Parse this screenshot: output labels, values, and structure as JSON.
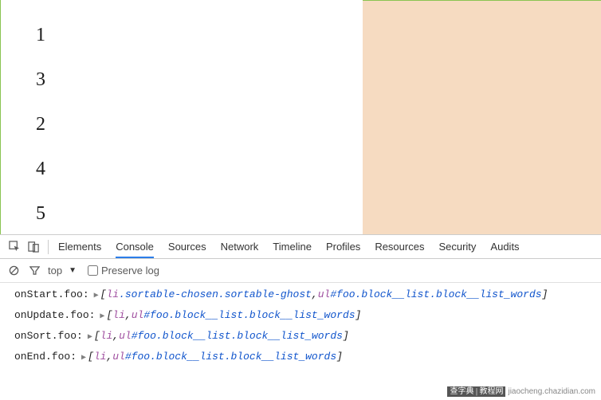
{
  "list": [
    "1",
    "3",
    "2",
    "4",
    "5"
  ],
  "devtools": {
    "tabs": [
      "Elements",
      "Console",
      "Sources",
      "Network",
      "Timeline",
      "Profiles",
      "Resources",
      "Security",
      "Audits"
    ],
    "active_tab": "Console",
    "context": "top",
    "preserve_label": "Preserve log",
    "preserve_checked": false
  },
  "logs": [
    {
      "label": "onStart.foo:",
      "parts": [
        {
          "t": "br",
          "v": "["
        },
        {
          "t": "el",
          "v": "li"
        },
        {
          "t": "sel",
          "v": ".sortable-chosen.sortable-ghost"
        },
        {
          "t": "c",
          "v": ", "
        },
        {
          "t": "el",
          "v": "ul"
        },
        {
          "t": "sel",
          "v": "#foo.block__list.block__list_words"
        },
        {
          "t": "br",
          "v": "]"
        }
      ]
    },
    {
      "label": "onUpdate.foo:",
      "parts": [
        {
          "t": "br",
          "v": "["
        },
        {
          "t": "el",
          "v": "li"
        },
        {
          "t": "c",
          "v": ", "
        },
        {
          "t": "el",
          "v": "ul"
        },
        {
          "t": "sel",
          "v": "#foo.block__list.block__list_words"
        },
        {
          "t": "br",
          "v": "]"
        }
      ]
    },
    {
      "label": "onSort.foo:",
      "parts": [
        {
          "t": "br",
          "v": "["
        },
        {
          "t": "el",
          "v": "li"
        },
        {
          "t": "c",
          "v": ", "
        },
        {
          "t": "el",
          "v": "ul"
        },
        {
          "t": "sel",
          "v": "#foo.block__list.block__list_words"
        },
        {
          "t": "br",
          "v": "]"
        }
      ]
    },
    {
      "label": "onEnd.foo:",
      "parts": [
        {
          "t": "br",
          "v": "["
        },
        {
          "t": "el",
          "v": "li"
        },
        {
          "t": "c",
          "v": ", "
        },
        {
          "t": "el",
          "v": "ul"
        },
        {
          "t": "sel",
          "v": "#foo.block__list.block__list_words"
        },
        {
          "t": "br",
          "v": "]"
        }
      ]
    }
  ],
  "watermark": {
    "cn": "查字典 | 教程网",
    "url": "jiaocheng.chazidian.com"
  }
}
